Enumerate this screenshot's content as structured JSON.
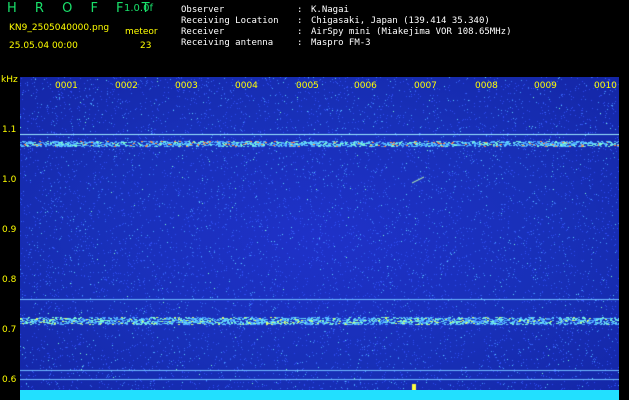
{
  "header": {
    "app_name": "H R O F F T",
    "version": "1.0.0f",
    "file_name": "KN9_2505040000.png",
    "datetime": "25.05.04 00:00",
    "meteor_label": "meteor",
    "meteor_count": "23"
  },
  "meta": {
    "rows": [
      {
        "key": "Observer",
        "sep": ":",
        "value": "K.Nagai"
      },
      {
        "key": "Receiving Location",
        "sep": ":",
        "value": "Chigasaki, Japan (139.414 35.340)"
      },
      {
        "key": "Receiver",
        "sep": ":",
        "value": "AirSpy mini (Miakejima VOR 108.65MHz)"
      },
      {
        "key": "Receiving antenna",
        "sep": ":",
        "value": "Maspro FM-3"
      }
    ]
  },
  "spectrogram": {
    "y_unit": "kHz",
    "y_ticks": [
      "1.1",
      "1.0",
      "0.9",
      "0.8",
      "0.7",
      "0.6"
    ],
    "x_ticks": [
      "0001",
      "0002",
      "0003",
      "0004",
      "0005",
      "0006",
      "0007",
      "0008",
      "0009",
      "0010"
    ],
    "colors": {
      "background": "#1a2fb8",
      "label": "#ffff00",
      "timebar": "#22e0ff"
    }
  }
}
